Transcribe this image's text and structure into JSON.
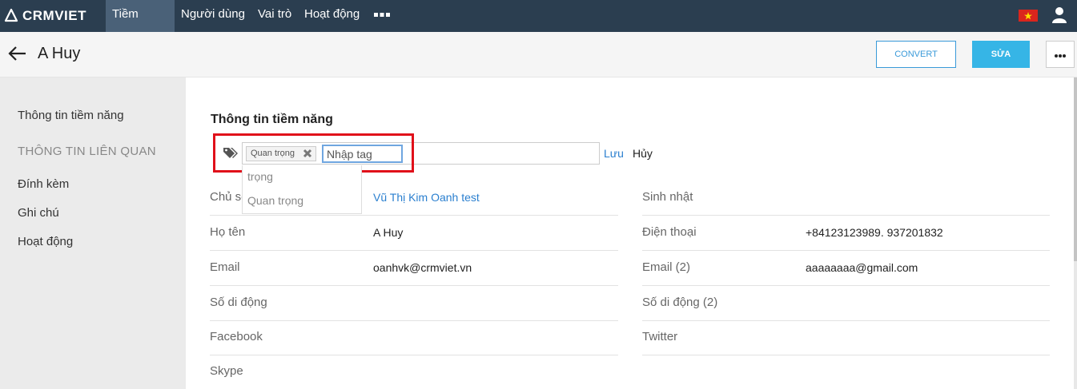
{
  "app": {
    "name": "CRMVIET"
  },
  "nav": {
    "items": [
      "Tiềm năng",
      "Người dùng",
      "Vai trò",
      "Hoạt động"
    ],
    "more_icon": "more-dots-icon",
    "flag_icon": "vietnam-flag-icon",
    "user_icon": "user-icon"
  },
  "header": {
    "title": "A Huy",
    "convert_label": "CONVERT",
    "edit_label": "SỬA"
  },
  "sidebar": {
    "item_info": "Thông tin tiềm năng",
    "heading_related": "THÔNG TIN LIÊN QUAN",
    "items": [
      "Đính kèm",
      "Ghi chú",
      "Hoạt động"
    ]
  },
  "main": {
    "section_title": "Thông tin tiềm năng",
    "tags": {
      "chip_label": "Quan trọng",
      "input_value": "Nhập tag",
      "save_label": "Lưu",
      "cancel_label": "Hủy",
      "suggestions": [
        "trọng",
        "Quan trọng"
      ]
    },
    "fields_left": [
      {
        "label": "Chủ sở hữu",
        "value": "Vũ Thị Kim Oanh test"
      },
      {
        "label": "Họ tên",
        "value": "A Huy"
      },
      {
        "label": "Email",
        "value": "oanhvk@crmviet.vn"
      },
      {
        "label": "Số di động",
        "value": ""
      },
      {
        "label": "Facebook",
        "value": ""
      },
      {
        "label": "Skype",
        "value": ""
      }
    ],
    "fields_right": [
      {
        "label": "Sinh nhật",
        "value": ""
      },
      {
        "label": "Điện thoại",
        "value": "+84123123989. 937201832"
      },
      {
        "label": "Email (2)",
        "value": "aaaaaaaa@gmail.com"
      },
      {
        "label": "Số di động (2)",
        "value": ""
      },
      {
        "label": "Twitter",
        "value": ""
      }
    ]
  },
  "colors": {
    "navbar": "#2b3e50",
    "accent": "#36b5e6",
    "link": "#2a7fcf",
    "highlight": "#e0101a"
  }
}
